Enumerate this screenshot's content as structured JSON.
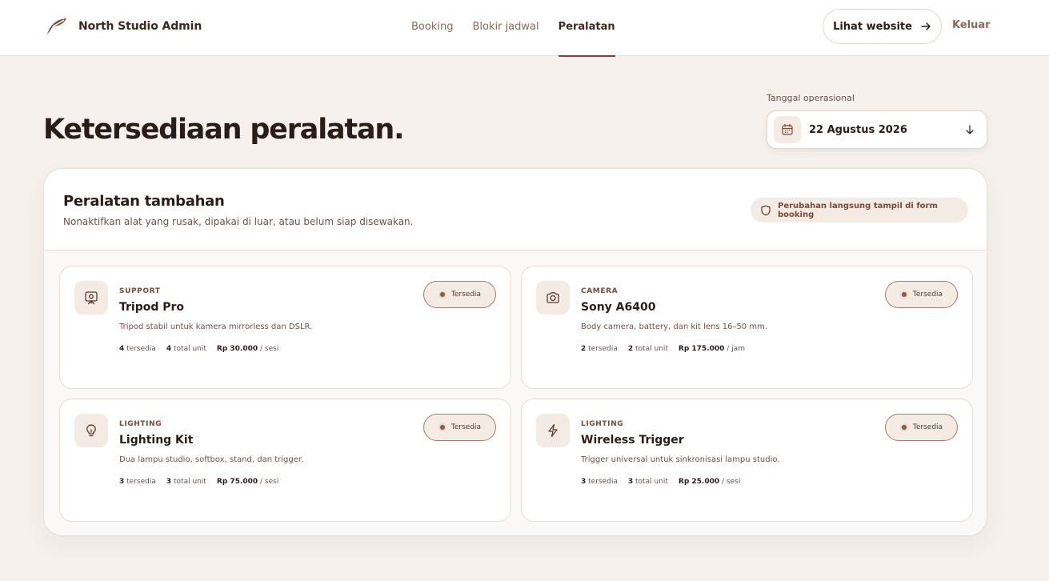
{
  "header": {
    "brand_name": "North Studio Admin",
    "nav": [
      {
        "label": "Booking",
        "active": false
      },
      {
        "label": "Blokir jadwal",
        "active": false
      },
      {
        "label": "Peralatan",
        "active": true
      }
    ],
    "website_button": "Lihat website",
    "logout": "Keluar"
  },
  "page": {
    "title": "Ketersediaan peralatan.",
    "date_label": "Tanggal operasional",
    "date_value": "22 Agustus 2026"
  },
  "panel": {
    "title": "Peralatan tambahan",
    "subtitle": "Nonaktifkan alat yang rusak, dipakai di luar, atau belum siap disewakan.",
    "notice": "Perubahan langsung tampil di form booking"
  },
  "equipment": [
    {
      "category": "SUPPORT",
      "name": "Tripod Pro",
      "description": "Tripod stabil untuk kamera mirrorless dan DSLR.",
      "available": "4",
      "available_label": "tersedia",
      "total": "4",
      "total_label": "total unit",
      "price": "Rp 30.000",
      "unit": "/ sesi",
      "status": "Tersedia",
      "icon": "tripod-icon"
    },
    {
      "category": "CAMERA",
      "name": "Sony A6400",
      "description": "Body camera, battery, dan kit lens 16–50 mm.",
      "available": "2",
      "available_label": "tersedia",
      "total": "2",
      "total_label": "total unit",
      "price": "Rp 175.000",
      "unit": "/ jam",
      "status": "Tersedia",
      "icon": "camera-icon"
    },
    {
      "category": "LIGHTING",
      "name": "Lighting Kit",
      "description": "Dua lampu studio, softbox, stand, dan trigger.",
      "available": "3",
      "available_label": "tersedia",
      "total": "3",
      "total_label": "total unit",
      "price": "Rp 75.000",
      "unit": "/ sesi",
      "status": "Tersedia",
      "icon": "lightbulb-icon"
    },
    {
      "category": "LIGHTING",
      "name": "Wireless Trigger",
      "description": "Trigger universal untuk sinkronisasi lampu studio.",
      "available": "3",
      "available_label": "tersedia",
      "total": "3",
      "total_label": "total unit",
      "price": "Rp 25.000",
      "unit": "/ sesi",
      "status": "Tersedia",
      "icon": "lightning-icon"
    }
  ],
  "colors": {
    "accent": "#7a4a35",
    "background": "#f6f1ed",
    "chip": "#f4ebe5"
  }
}
